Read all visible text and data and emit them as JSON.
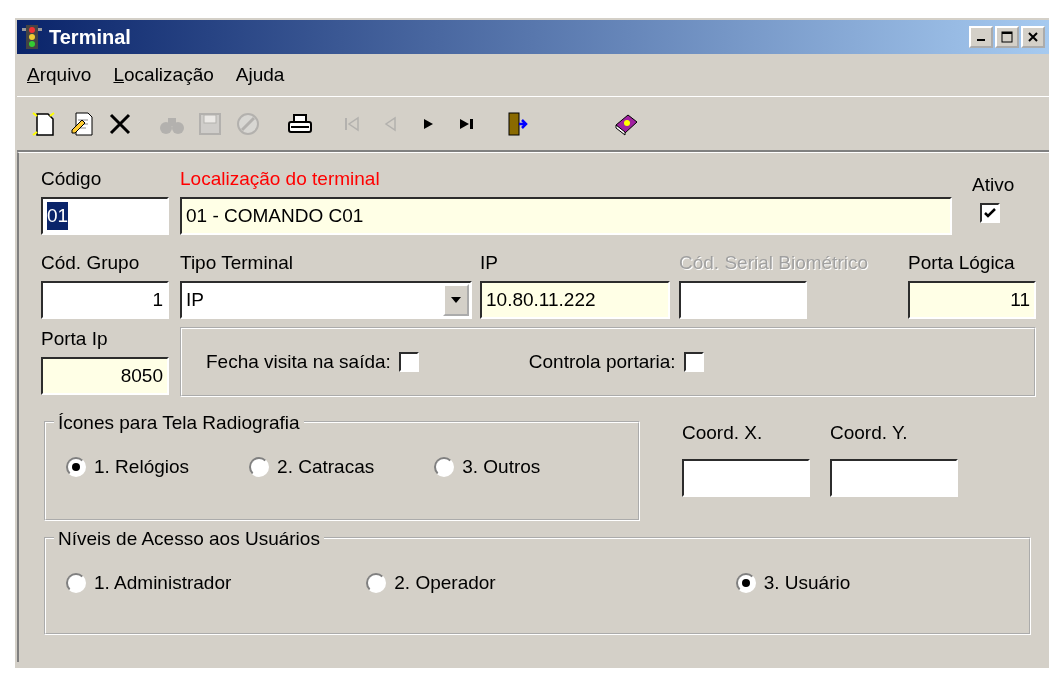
{
  "window": {
    "title": "Terminal"
  },
  "menu": [
    {
      "accel": "A",
      "after": "rquivo"
    },
    {
      "accel": "L",
      "after": "ocalização"
    },
    {
      "before": "A",
      "accel": "j",
      "after": "uda"
    }
  ],
  "toolbar": [
    {
      "kind": "new",
      "disabled": false
    },
    {
      "kind": "edit",
      "disabled": false
    },
    {
      "kind": "delete",
      "disabled": false
    },
    {
      "kind": "find",
      "disabled": true
    },
    {
      "kind": "save",
      "disabled": true
    },
    {
      "kind": "cancel",
      "disabled": true
    },
    {
      "kind": "print",
      "disabled": false
    },
    {
      "kind": "first",
      "disabled": true
    },
    {
      "kind": "prev",
      "disabled": true
    },
    {
      "kind": "next",
      "disabled": false
    },
    {
      "kind": "last",
      "disabled": false
    },
    {
      "kind": "exit",
      "disabled": false
    },
    {
      "kind": "help",
      "disabled": false
    }
  ],
  "row1": [
    {
      "label": "Código",
      "value": "01",
      "highlighted": false,
      "text_selected": true
    },
    {
      "label": "Localização do terminal",
      "value": "01 - COMANDO C01",
      "highlighted": true,
      "required": true
    }
  ],
  "ativo": {
    "label": "Ativo",
    "checked": true
  },
  "row2": [
    {
      "label": "Cód. Grupo",
      "value": "1",
      "kind": "number",
      "highlighted": false
    },
    {
      "label": "Tipo Terminal",
      "value": "IP",
      "kind": "select",
      "highlighted": false
    },
    {
      "label": "IP",
      "value": "10.80.11.222",
      "kind": "text",
      "highlighted": true
    },
    {
      "label": "Cód. Serial Biométrico",
      "kind": "text",
      "highlighted": false,
      "disabled": true
    },
    {
      "label": "Porta Lógica",
      "value": "11",
      "kind": "number",
      "highlighted": true
    }
  ],
  "porta_ip": {
    "label": "Porta Ip",
    "value": "8050",
    "highlighted": true
  },
  "options": [
    {
      "label": "Fecha visita na saída:",
      "checked": false
    },
    {
      "label": "Controla portaria:",
      "checked": false
    }
  ],
  "icones": {
    "title": "Ícones para Tela Radiografia",
    "options": [
      {
        "label": "1. Relógios",
        "selected": true
      },
      {
        "label": "2. Catracas",
        "selected": false
      },
      {
        "label": "3. Outros",
        "selected": false
      }
    ]
  },
  "coords": [
    {
      "label": "Coord. X."
    },
    {
      "label": "Coord. Y."
    }
  ],
  "niveis": {
    "title": "Níveis de Acesso aos Usuários",
    "options": [
      {
        "label": "1. Administrador",
        "selected": false
      },
      {
        "label": "2. Operador",
        "selected": false
      },
      {
        "label": "3. Usuário",
        "selected": true
      }
    ]
  }
}
